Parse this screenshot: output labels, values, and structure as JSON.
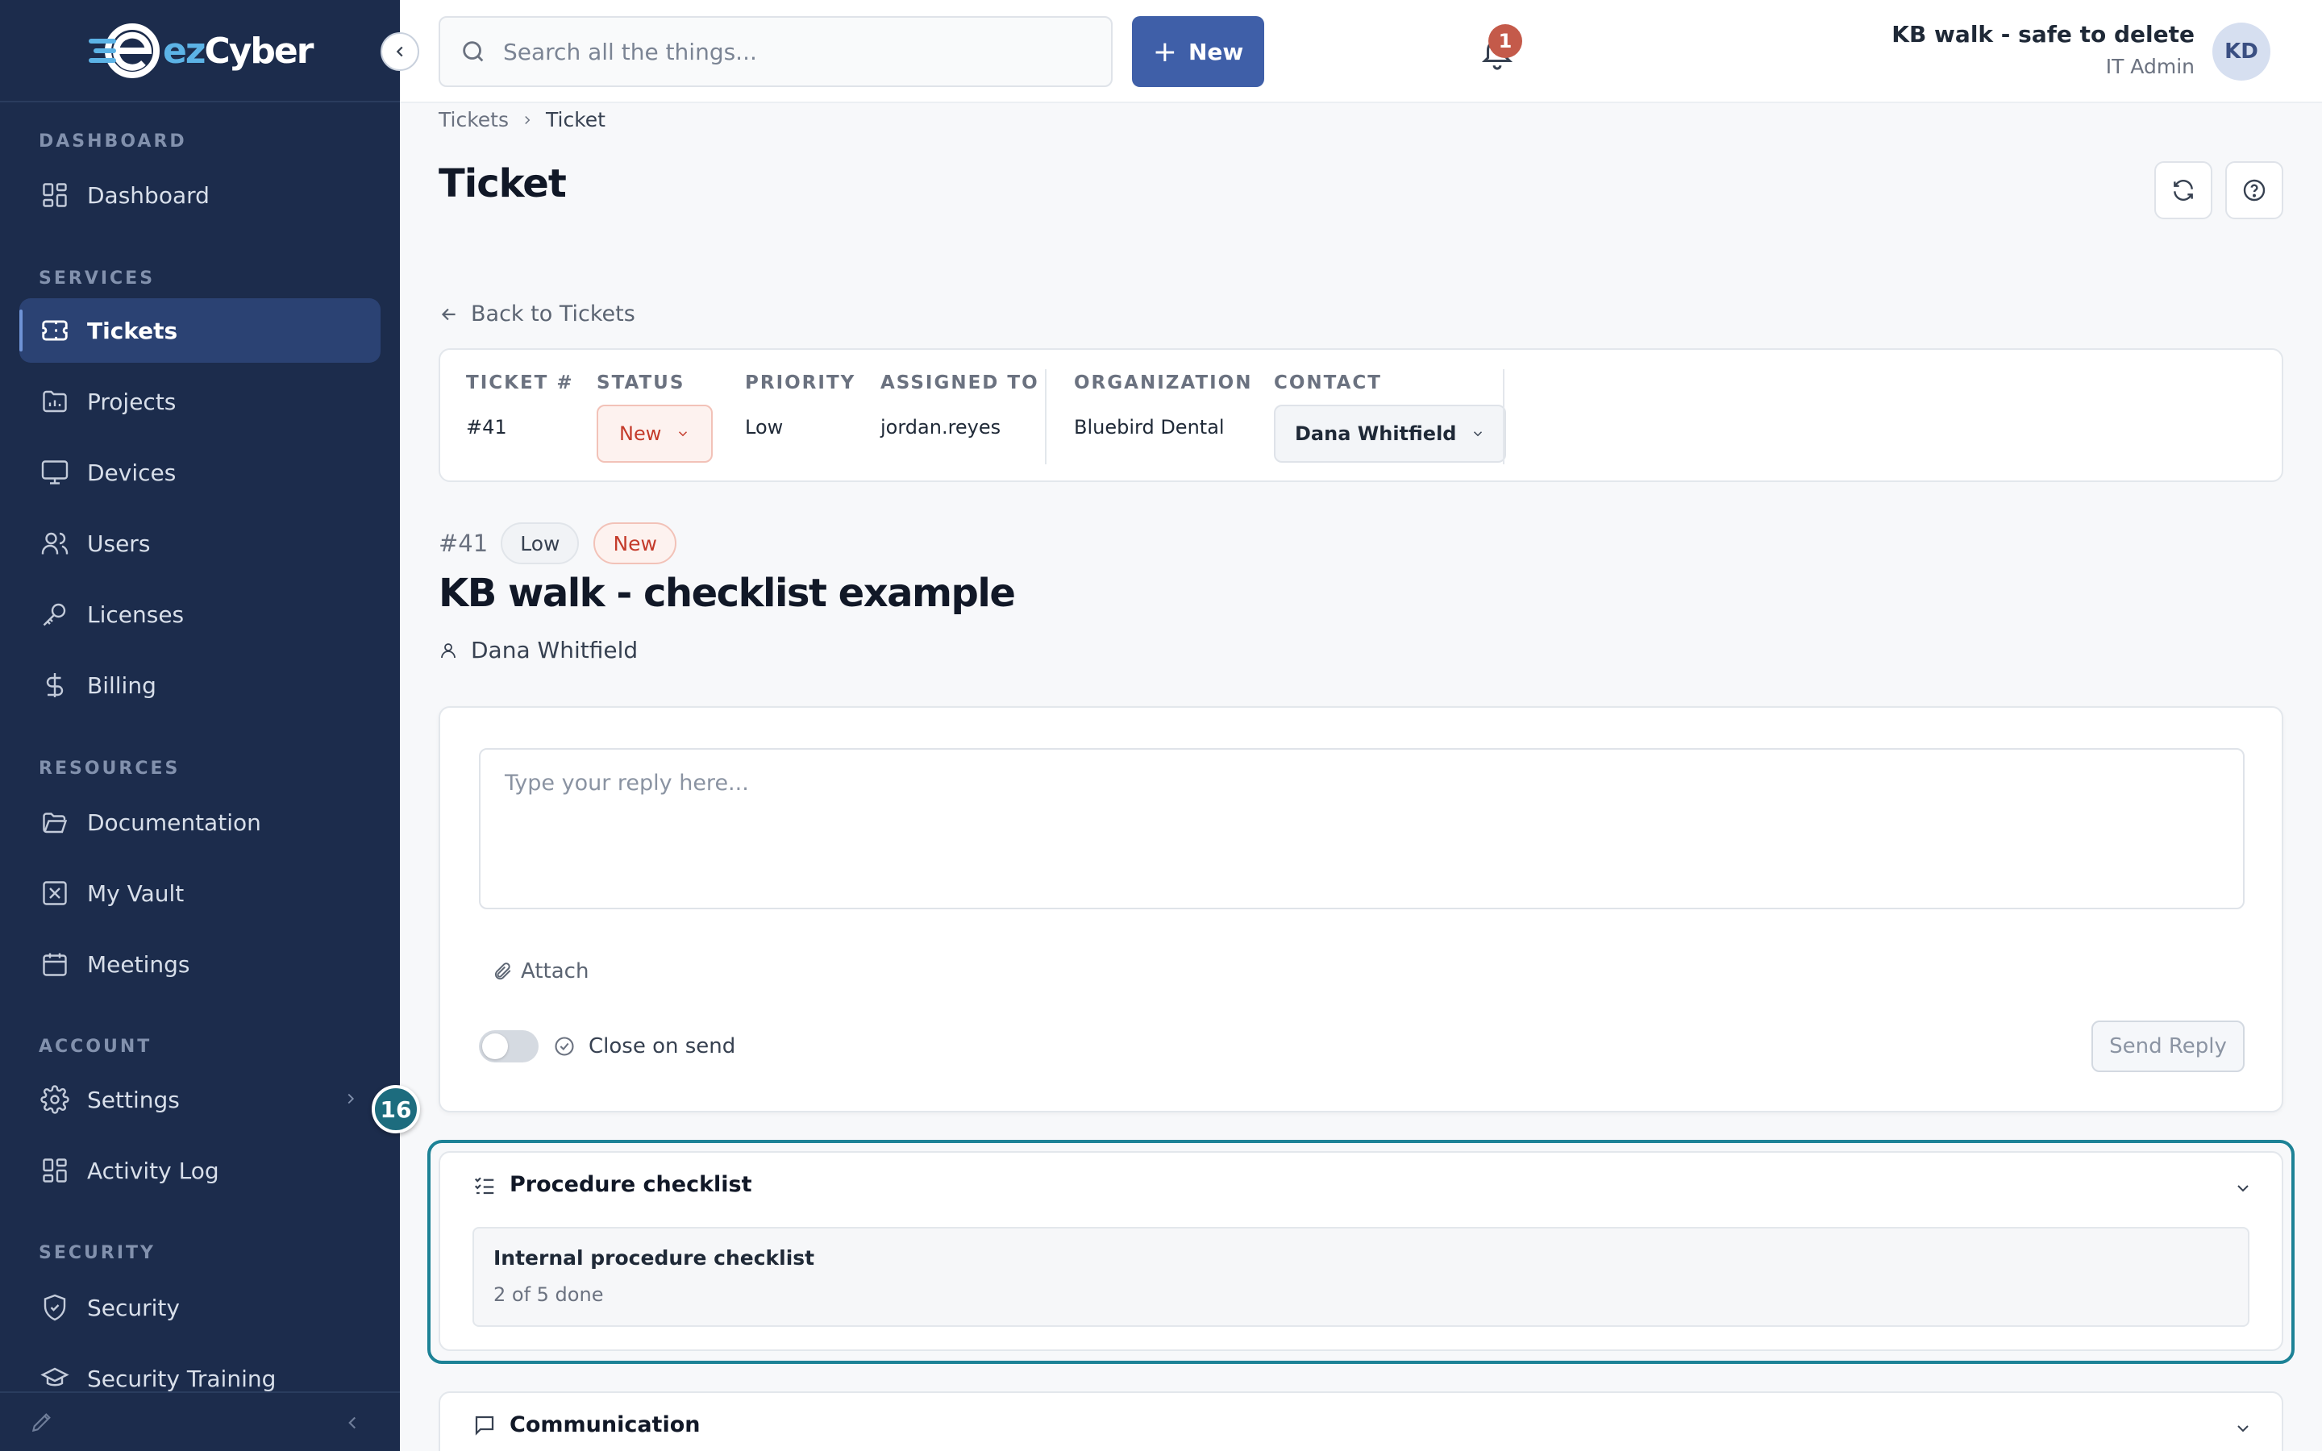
{
  "app": {
    "logo_text_ez": "ez",
    "logo_text_cyber": "Cyber"
  },
  "sidebar": {
    "sections": {
      "dashboard": "DASHBOARD",
      "services": "SERVICES",
      "resources": "RESOURCES",
      "account": "ACCOUNT",
      "security": "SECURITY"
    },
    "items": {
      "dashboard": "Dashboard",
      "tickets": "Tickets",
      "projects": "Projects",
      "devices": "Devices",
      "users": "Users",
      "licenses": "Licenses",
      "billing": "Billing",
      "documentation": "Documentation",
      "vault": "My Vault",
      "meetings": "Meetings",
      "settings": "Settings",
      "activity": "Activity Log",
      "security": "Security",
      "training": "Security Training"
    },
    "active_item": "Tickets"
  },
  "tour": {
    "step": "16"
  },
  "header": {
    "search_placeholder": "Search all the things...",
    "new_button": "New",
    "notification_count": "1",
    "user_name": "KB walk - safe to delete",
    "user_role": "IT Admin",
    "user_initials": "KD"
  },
  "breadcrumb": {
    "parent": "Tickets",
    "current": "Ticket"
  },
  "page": {
    "title": "Ticket",
    "back_link": "Back to Tickets"
  },
  "ticket_meta": {
    "ticket_label": "TICKET #",
    "ticket_value": "#41",
    "status_label": "STATUS",
    "status_value": "New",
    "priority_label": "PRIORITY",
    "priority_value": "Low",
    "assigned_label": "ASSIGNED TO",
    "assigned_value": "jordan.reyes",
    "org_label": "ORGANIZATION",
    "org_value": "Bluebird Dental",
    "contact_label": "CONTACT",
    "contact_value": "Dana Whitfield"
  },
  "ticket": {
    "number": "#41",
    "priority_tag": "Low",
    "status_tag": "New",
    "title": "KB walk - checklist example",
    "contact": "Dana Whitfield"
  },
  "reply": {
    "placeholder": "Type your reply here...",
    "attach": "Attach",
    "close_on_send": "Close on send",
    "close_on_send_enabled": false,
    "send_button": "Send Reply"
  },
  "checklist_panel": {
    "title": "Procedure checklist",
    "item_title": "Internal procedure checklist",
    "item_progress": "2 of 5 done"
  },
  "communication_panel": {
    "title": "Communication"
  },
  "colors": {
    "sidebar_bg": "#1c2c4c",
    "accent": "#3f5fa8",
    "status_new": "#c43b2b",
    "highlight": "#1d8296"
  }
}
